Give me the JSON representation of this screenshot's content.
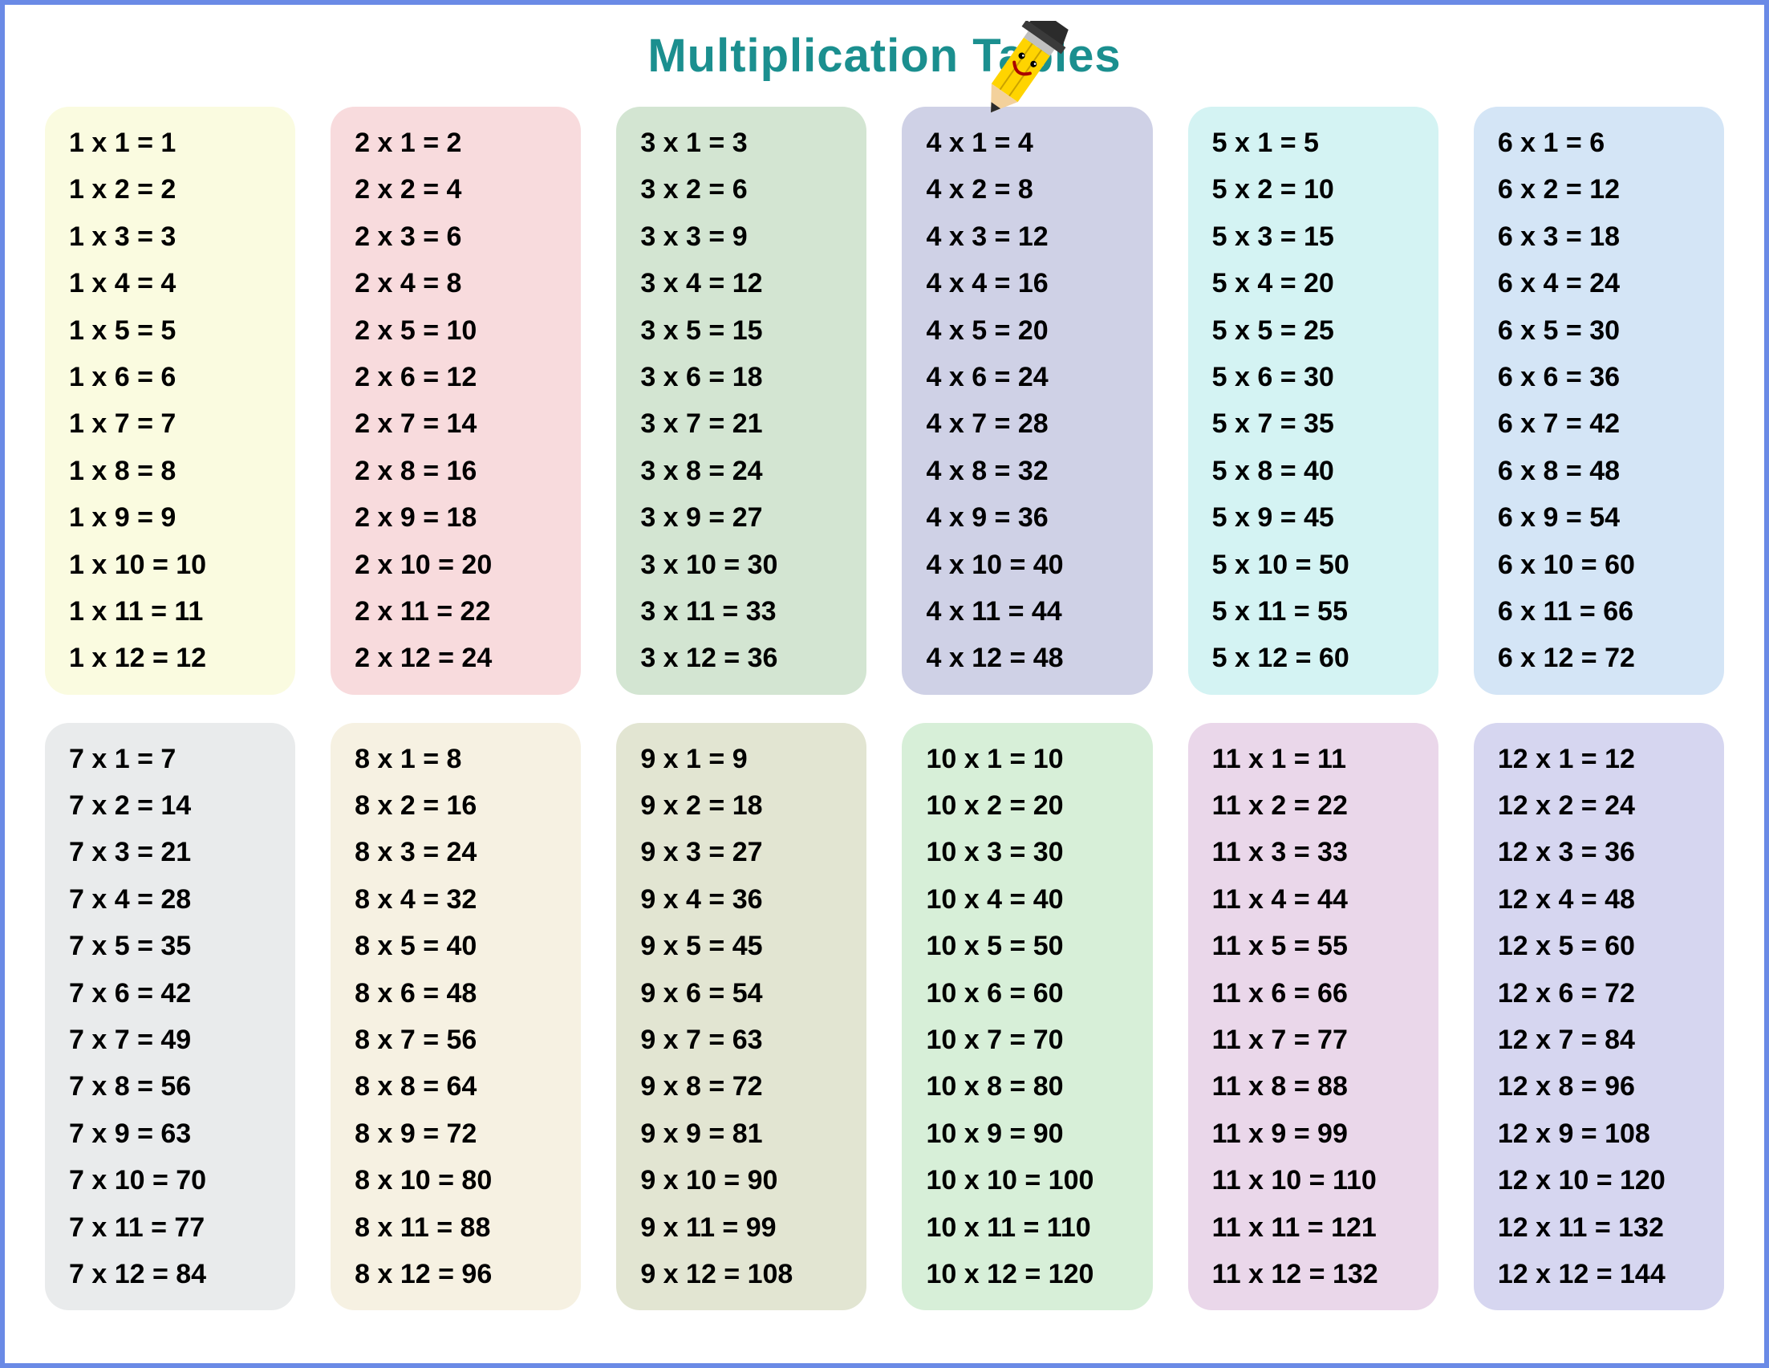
{
  "title": "Multiplication Tables",
  "chart_data": {
    "type": "table",
    "title": "Multiplication Tables",
    "description": "12 multiplication tables, each listing factor × 1 through factor × 12 with products.",
    "tables": [
      {
        "factor": 1,
        "color": "#fafbe0",
        "rows": [
          [
            1,
            1,
            1
          ],
          [
            1,
            2,
            2
          ],
          [
            1,
            3,
            3
          ],
          [
            1,
            4,
            4
          ],
          [
            1,
            5,
            5
          ],
          [
            1,
            6,
            6
          ],
          [
            1,
            7,
            7
          ],
          [
            1,
            8,
            8
          ],
          [
            1,
            9,
            9
          ],
          [
            1,
            10,
            10
          ],
          [
            1,
            11,
            11
          ],
          [
            1,
            12,
            12
          ]
        ]
      },
      {
        "factor": 2,
        "color": "#f8dbdd",
        "rows": [
          [
            2,
            1,
            2
          ],
          [
            2,
            2,
            4
          ],
          [
            2,
            3,
            6
          ],
          [
            2,
            4,
            8
          ],
          [
            2,
            5,
            10
          ],
          [
            2,
            6,
            12
          ],
          [
            2,
            7,
            14
          ],
          [
            2,
            8,
            16
          ],
          [
            2,
            9,
            18
          ],
          [
            2,
            10,
            20
          ],
          [
            2,
            11,
            22
          ],
          [
            2,
            12,
            24
          ]
        ]
      },
      {
        "factor": 3,
        "color": "#d3e5d2",
        "rows": [
          [
            3,
            1,
            3
          ],
          [
            3,
            2,
            6
          ],
          [
            3,
            3,
            9
          ],
          [
            3,
            4,
            12
          ],
          [
            3,
            5,
            15
          ],
          [
            3,
            6,
            18
          ],
          [
            3,
            7,
            21
          ],
          [
            3,
            8,
            24
          ],
          [
            3,
            9,
            27
          ],
          [
            3,
            10,
            30
          ],
          [
            3,
            11,
            33
          ],
          [
            3,
            12,
            36
          ]
        ]
      },
      {
        "factor": 4,
        "color": "#cfd1e6",
        "rows": [
          [
            4,
            1,
            4
          ],
          [
            4,
            2,
            8
          ],
          [
            4,
            3,
            12
          ],
          [
            4,
            4,
            16
          ],
          [
            4,
            5,
            20
          ],
          [
            4,
            6,
            24
          ],
          [
            4,
            7,
            28
          ],
          [
            4,
            8,
            32
          ],
          [
            4,
            9,
            36
          ],
          [
            4,
            10,
            40
          ],
          [
            4,
            11,
            44
          ],
          [
            4,
            12,
            48
          ]
        ]
      },
      {
        "factor": 5,
        "color": "#d4f3f3",
        "rows": [
          [
            5,
            1,
            5
          ],
          [
            5,
            2,
            10
          ],
          [
            5,
            3,
            15
          ],
          [
            5,
            4,
            20
          ],
          [
            5,
            5,
            25
          ],
          [
            5,
            6,
            30
          ],
          [
            5,
            7,
            35
          ],
          [
            5,
            8,
            40
          ],
          [
            5,
            9,
            45
          ],
          [
            5,
            10,
            50
          ],
          [
            5,
            11,
            55
          ],
          [
            5,
            12,
            60
          ]
        ]
      },
      {
        "factor": 6,
        "color": "#d4e5f6",
        "rows": [
          [
            6,
            1,
            6
          ],
          [
            6,
            2,
            12
          ],
          [
            6,
            3,
            18
          ],
          [
            6,
            4,
            24
          ],
          [
            6,
            5,
            30
          ],
          [
            6,
            6,
            36
          ],
          [
            6,
            7,
            42
          ],
          [
            6,
            8,
            48
          ],
          [
            6,
            9,
            54
          ],
          [
            6,
            10,
            60
          ],
          [
            6,
            11,
            66
          ],
          [
            6,
            12,
            72
          ]
        ]
      },
      {
        "factor": 7,
        "color": "#e9ebec",
        "rows": [
          [
            7,
            1,
            7
          ],
          [
            7,
            2,
            14
          ],
          [
            7,
            3,
            21
          ],
          [
            7,
            4,
            28
          ],
          [
            7,
            5,
            35
          ],
          [
            7,
            6,
            42
          ],
          [
            7,
            7,
            49
          ],
          [
            7,
            8,
            56
          ],
          [
            7,
            9,
            63
          ],
          [
            7,
            10,
            70
          ],
          [
            7,
            11,
            77
          ],
          [
            7,
            12,
            84
          ]
        ]
      },
      {
        "factor": 8,
        "color": "#f6f1e2",
        "rows": [
          [
            8,
            1,
            8
          ],
          [
            8,
            2,
            16
          ],
          [
            8,
            3,
            24
          ],
          [
            8,
            4,
            32
          ],
          [
            8,
            5,
            40
          ],
          [
            8,
            6,
            48
          ],
          [
            8,
            7,
            56
          ],
          [
            8,
            8,
            64
          ],
          [
            8,
            9,
            72
          ],
          [
            8,
            10,
            80
          ],
          [
            8,
            11,
            88
          ],
          [
            8,
            12,
            96
          ]
        ]
      },
      {
        "factor": 9,
        "color": "#e2e5d2",
        "rows": [
          [
            9,
            1,
            9
          ],
          [
            9,
            2,
            18
          ],
          [
            9,
            3,
            27
          ],
          [
            9,
            4,
            36
          ],
          [
            9,
            5,
            45
          ],
          [
            9,
            6,
            54
          ],
          [
            9,
            7,
            63
          ],
          [
            9,
            8,
            72
          ],
          [
            9,
            9,
            81
          ],
          [
            9,
            10,
            90
          ],
          [
            9,
            11,
            99
          ],
          [
            9,
            12,
            108
          ]
        ]
      },
      {
        "factor": 10,
        "color": "#d7efd8",
        "rows": [
          [
            10,
            1,
            10
          ],
          [
            10,
            2,
            20
          ],
          [
            10,
            3,
            30
          ],
          [
            10,
            4,
            40
          ],
          [
            10,
            5,
            50
          ],
          [
            10,
            6,
            60
          ],
          [
            10,
            7,
            70
          ],
          [
            10,
            8,
            80
          ],
          [
            10,
            9,
            90
          ],
          [
            10,
            10,
            100
          ],
          [
            10,
            11,
            110
          ],
          [
            10,
            12,
            120
          ]
        ]
      },
      {
        "factor": 11,
        "color": "#ead7ea",
        "rows": [
          [
            11,
            1,
            11
          ],
          [
            11,
            2,
            22
          ],
          [
            11,
            3,
            33
          ],
          [
            11,
            4,
            44
          ],
          [
            11,
            5,
            55
          ],
          [
            11,
            6,
            66
          ],
          [
            11,
            7,
            77
          ],
          [
            11,
            8,
            88
          ],
          [
            11,
            9,
            99
          ],
          [
            11,
            10,
            110
          ],
          [
            11,
            11,
            121
          ],
          [
            11,
            12,
            132
          ]
        ]
      },
      {
        "factor": 12,
        "color": "#d6d6f0",
        "rows": [
          [
            12,
            1,
            12
          ],
          [
            12,
            2,
            24
          ],
          [
            12,
            3,
            36
          ],
          [
            12,
            4,
            48
          ],
          [
            12,
            5,
            60
          ],
          [
            12,
            6,
            72
          ],
          [
            12,
            7,
            84
          ],
          [
            12,
            8,
            96
          ],
          [
            12,
            9,
            108
          ],
          [
            12,
            10,
            120
          ],
          [
            12,
            11,
            132
          ],
          [
            12,
            12,
            144
          ]
        ]
      }
    ]
  }
}
